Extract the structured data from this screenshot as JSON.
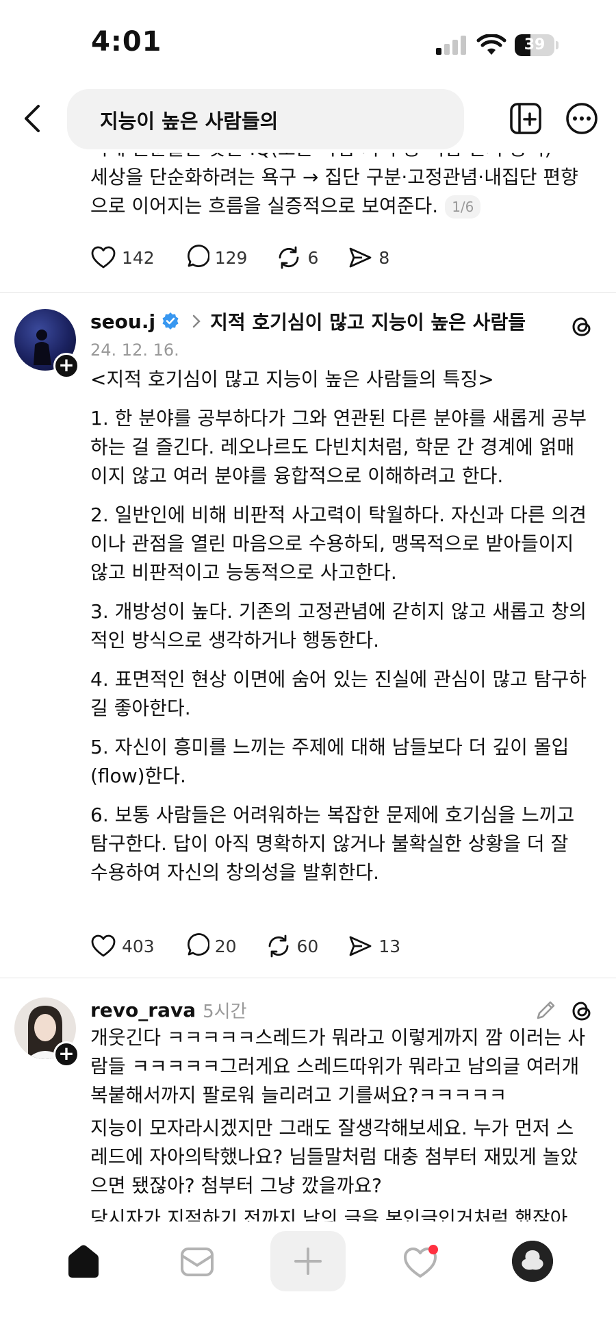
{
  "status_bar": {
    "time": "4:01",
    "battery": "39",
    "battery_level_percent": 39
  },
  "header": {
    "search_query": "지능이 높은 사람들의"
  },
  "post_prev": {
    "lines": [
      "이데 권준들은 낮은 IQ(도는 작업-기억 등 핵심 인지 능력) →",
      "세상을 단순화하려는 욕구 → 집단 구분·고정관념·내집단 편향",
      "으로 이어지는 흐름을 실증적으로 보여준다."
    ],
    "counter": "1/6",
    "likes": "142",
    "comments": "129",
    "reposts": "6",
    "shares": "8"
  },
  "post_seou": {
    "username": "seou.j",
    "topic": "지적 호기심이 많고 지능이 높은 사람들",
    "date": "24. 12. 16.",
    "paragraphs": [
      [
        "<지적 호기심이 많고 지능이 높은 사람들의 특징>"
      ],
      [
        "1. 한 분야를 공부하다가 그와 연관된 다른 분야를 새롭게 공부",
        "하는 걸 즐긴다. 레오나르도 다빈치처럼, 학문 간 경계에 얽매",
        "이지 않고 여러 분야를 융합적으로 이해하려고 한다."
      ],
      [
        "2. 일반인에 비해 비판적 사고력이 탁월하다. 자신과 다른 의견",
        "이나 관점을 열린 마음으로 수용하되, 맹목적으로 받아들이지",
        "않고 비판적이고 능동적으로 사고한다."
      ],
      [
        "3. 개방성이 높다. 기존의 고정관념에 갇히지 않고 새롭고 창의",
        "적인 방식으로 생각하거나 행동한다."
      ],
      [
        "4. 표면적인 현상 이면에 숨어 있는 진실에 관심이 많고 탐구하",
        "길 좋아한다."
      ],
      [
        "5. 자신이 흥미를 느끼는 주제에 대해 남들보다 더 깊이 몰입",
        "(flow)한다."
      ],
      [
        "6. 보통 사람들은 어려워하는 복잡한 문제에 호기심을 느끼고",
        "탐구한다. 답이 아직 명확하지 않거나 불확실한 상황을 더 잘",
        "수용하여 자신의 창의성을 발휘한다."
      ]
    ],
    "likes": "403",
    "comments": "20",
    "reposts": "60",
    "shares": "13"
  },
  "post_revo": {
    "username": "revo_rava",
    "time": "5시간",
    "paragraphs": [
      [
        "개웃긴다 ㅋㅋㅋㅋㅋ스레드가 뭐라고 이렇게까지 깜 이러는 사",
        "람들 ㅋㅋㅋㅋㅋ그러게요 스레드따위가 뭐라고 남의글 여러개",
        "복붙해서까지 팔로워 늘리려고 기를써요?ㅋㅋㅋㅋㅋ"
      ],
      [
        "지능이 모자라시겠지만 그래도 잘생각해보세요. 누가 먼저 스",
        "레드에 자아의탁했나요? 님들말처럼 대충 첨부터 재밌게 놀았",
        "으면 됐잖아? 첨부터 그냥 깠을까요?"
      ],
      [
        "당시자가 지적하기 전까지 남의 글을 본인글인거처럼 했잖아"
      ]
    ]
  },
  "colors": {
    "verified": "#3897f0",
    "notification_dot": "#ff3040",
    "muted": "#999999"
  },
  "icons": {
    "back": "chevron-left-icon",
    "compose": "new-post-icon",
    "more": "more-icon",
    "like": "heart-icon",
    "comment": "comment-icon",
    "repost": "repost-icon",
    "share": "send-icon",
    "threads": "threads-logo-icon",
    "edit": "pencil-icon",
    "nav": [
      "home-icon",
      "inbox-icon",
      "plus-icon",
      "activity-icon",
      "profile-icon"
    ]
  }
}
